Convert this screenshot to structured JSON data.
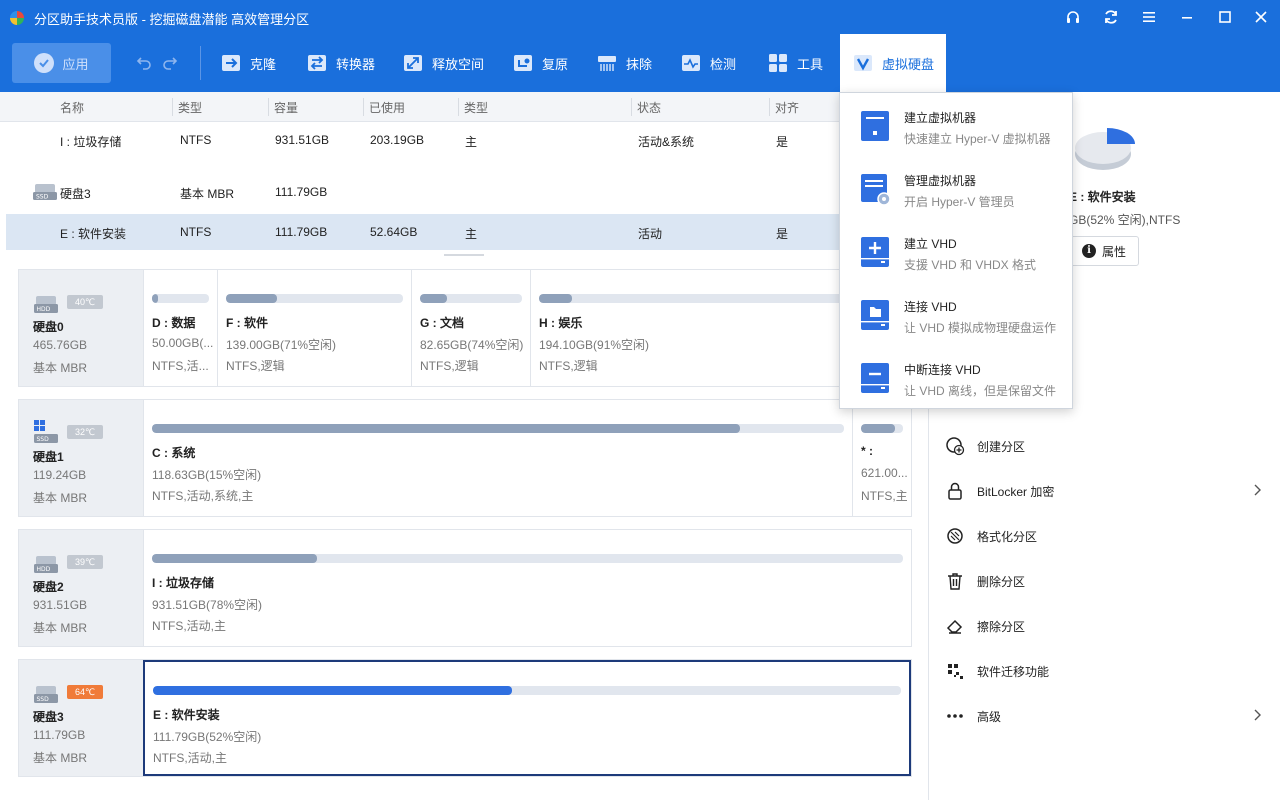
{
  "window": {
    "title": "分区助手技术员版 - 挖掘磁盘潜能 高效管理分区"
  },
  "toolbar": {
    "apply_label": "应用",
    "tools": [
      {
        "label": "克隆",
        "icon": "clone-icon"
      },
      {
        "label": "转换器",
        "icon": "converter-icon"
      },
      {
        "label": "释放空间",
        "icon": "free-space-icon"
      },
      {
        "label": "复原",
        "icon": "restore-icon"
      },
      {
        "label": "抹除",
        "icon": "wipe-icon"
      },
      {
        "label": "检测",
        "icon": "check-icon"
      },
      {
        "label": "工具",
        "icon": "tools-icon"
      },
      {
        "label": "虚拟硬盘",
        "icon": "virtual-disk-icon"
      }
    ]
  },
  "table": {
    "columns": [
      "名称",
      "类型",
      "容量",
      "已使用",
      "类型",
      "状态",
      "对齐"
    ],
    "rows": [
      {
        "name": "I : 垃圾存储",
        "fs": "NTFS",
        "capacity": "931.51GB",
        "used": "203.19GB",
        "type": "主",
        "status": "活动&系统",
        "align": "是"
      },
      {
        "name": "硬盘3",
        "fs": "基本 MBR",
        "capacity": "111.79GB",
        "used": "",
        "type": "",
        "status": "",
        "align": ""
      },
      {
        "name": "E : 软件安装",
        "fs": "NTFS",
        "capacity": "111.79GB",
        "used": "52.64GB",
        "type": "主",
        "status": "活动",
        "align": "是"
      }
    ]
  },
  "disks": [
    {
      "name": "硬盘0",
      "size": "465.76GB",
      "type": "基本 MBR",
      "temp": "40℃",
      "temp_color": "#c2c8d0",
      "kind": "HDD",
      "partitions": [
        {
          "name": "D : 数据",
          "info": "50.00GB(...",
          "fs": "NTFS,活...",
          "used_pct": 10
        },
        {
          "name": "F : 软件",
          "info": "139.00GB(71%空闲)",
          "fs": "NTFS,逻辑",
          "used_pct": 29
        },
        {
          "name": "G : 文档",
          "info": "82.65GB(74%空闲)",
          "fs": "NTFS,逻辑",
          "used_pct": 26
        },
        {
          "name": "H : 娱乐",
          "info": "194.10GB(91%空闲)",
          "fs": "NTFS,逻辑",
          "used_pct": 9
        }
      ]
    },
    {
      "name": "硬盘1",
      "size": "119.24GB",
      "type": "基本 MBR",
      "temp": "32℃",
      "temp_color": "#c2c8d0",
      "kind": "SSD",
      "partitions": [
        {
          "name": "C : 系统",
          "info": "118.63GB(15%空闲)",
          "fs": "NTFS,活动,系统,主",
          "used_pct": 85
        },
        {
          "name": "* :",
          "info": "621.00...",
          "fs": "NTFS,主",
          "used_pct": 80
        }
      ]
    },
    {
      "name": "硬盘2",
      "size": "931.51GB",
      "type": "基本 MBR",
      "temp": "39℃",
      "temp_color": "#c2c8d0",
      "kind": "HDD",
      "partitions": [
        {
          "name": "I : 垃圾存储",
          "info": "931.51GB(78%空闲)",
          "fs": "NTFS,活动,主",
          "used_pct": 22
        }
      ]
    },
    {
      "name": "硬盘3",
      "size": "111.79GB",
      "type": "基本 MBR",
      "temp": "64℃",
      "temp_color": "#f07b39",
      "kind": "SSD",
      "partitions": [
        {
          "name": "E : 软件安装",
          "info": "111.79GB(52%空闲)",
          "fs": "NTFS,活动,主",
          "used_pct": 48
        }
      ]
    }
  ],
  "right_panel": {
    "title": "E : 软件安装",
    "subtitle": "GB(52% 空闲),NTFS",
    "properties_label": "属性",
    "operations": [
      {
        "label": "创建分区",
        "icon": "create-partition-icon",
        "has_submenu": false
      },
      {
        "label": "BitLocker 加密",
        "icon": "lock-icon",
        "has_submenu": true
      },
      {
        "label": "格式化分区",
        "icon": "format-icon",
        "has_submenu": false
      },
      {
        "label": "删除分区",
        "icon": "trash-icon",
        "has_submenu": false
      },
      {
        "label": "擦除分区",
        "icon": "eraser-icon",
        "has_submenu": false
      },
      {
        "label": "软件迁移功能",
        "icon": "migrate-icon",
        "has_submenu": false
      },
      {
        "label": "高级",
        "icon": "more-icon",
        "has_submenu": true
      }
    ]
  },
  "virtual_disk_menu": [
    {
      "title": "建立虚拟机器",
      "desc": "快速建立 Hyper-V 虚拟机器",
      "icon": "create-vm-icon"
    },
    {
      "title": "管理虚拟机器",
      "desc": "开启 Hyper-V 管理员",
      "icon": "manage-vm-icon"
    },
    {
      "title": "建立 VHD",
      "desc": "支援 VHD 和 VHDX 格式",
      "icon": "create-vhd-icon"
    },
    {
      "title": "连接 VHD",
      "desc": "让 VHD 模拟成物理硬盘运作",
      "icon": "connect-vhd-icon"
    },
    {
      "title": "中断连接 VHD",
      "desc": "让 VHD 离线，但是保留文件",
      "icon": "disconnect-vhd-icon"
    }
  ],
  "colors": {
    "brand": "#1a6fdc",
    "bar_fill": "#8fa1ba",
    "selected_bar_fill": "#2f6fe0",
    "selected_border": "#1d3a7a"
  }
}
